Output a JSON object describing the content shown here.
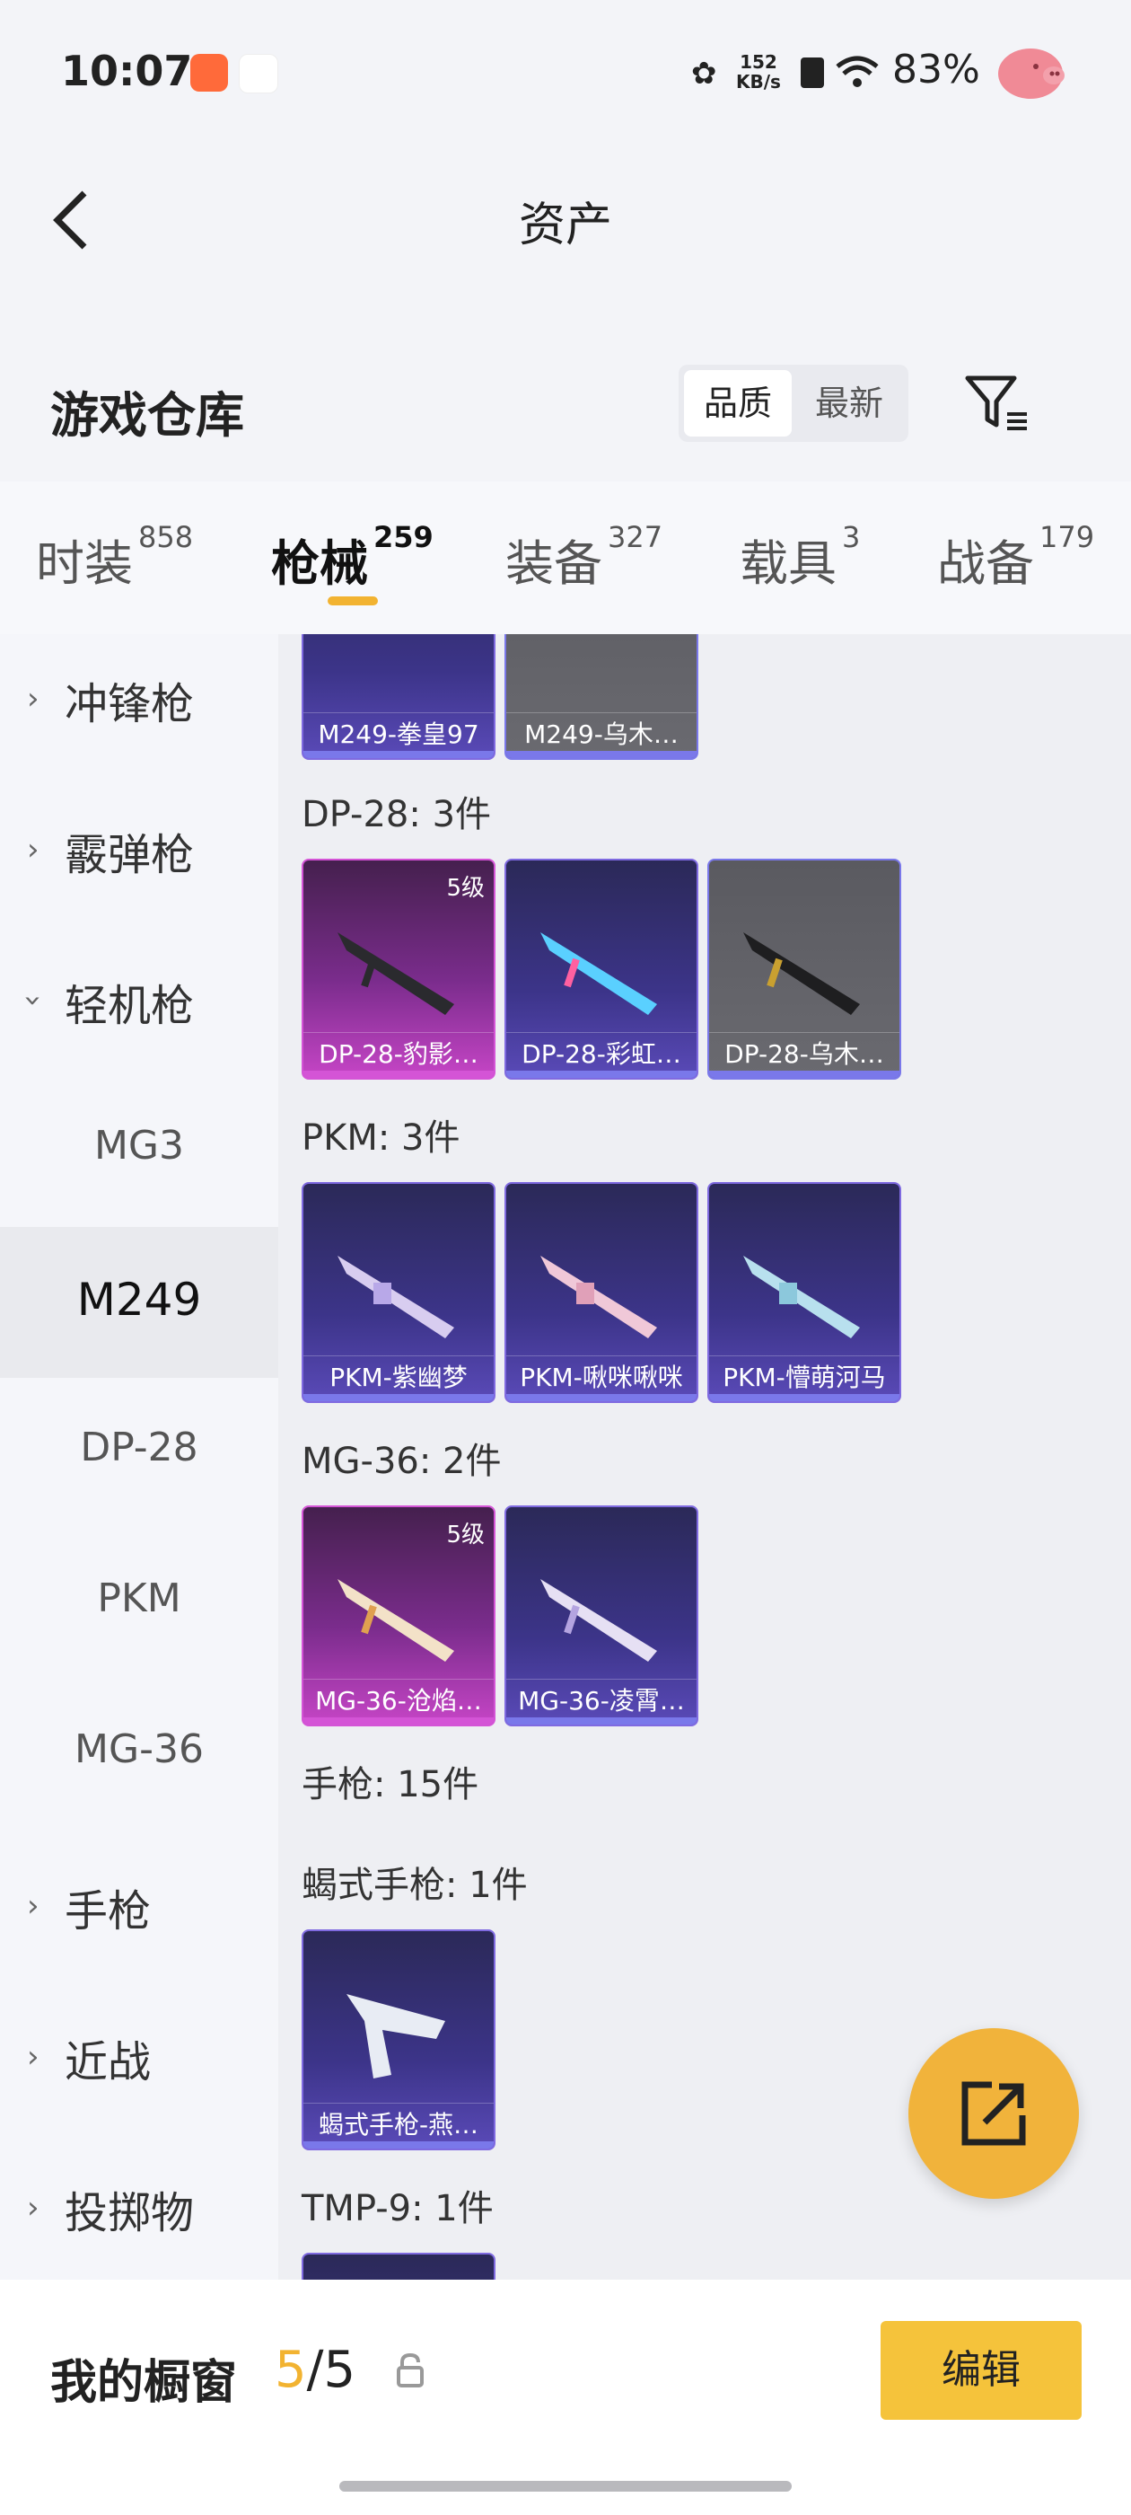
{
  "status": {
    "time": "10:07",
    "net_speed_value": "152",
    "net_speed_unit": "KB/s",
    "battery": "83%"
  },
  "header": {
    "title": "资产"
  },
  "warehouse": {
    "title": "游戏仓库",
    "sort_quality": "品质",
    "sort_latest": "最新"
  },
  "tabs": [
    {
      "label": "时装",
      "count": "858"
    },
    {
      "label": "枪械",
      "count": "259"
    },
    {
      "label": "装备",
      "count": "327"
    },
    {
      "label": "载具",
      "count": "3"
    },
    {
      "label": "战备",
      "count": "179"
    }
  ],
  "sidebar": {
    "categories": [
      {
        "label": "冲锋枪"
      },
      {
        "label": "霰弹枪"
      },
      {
        "label": "轻机枪"
      },
      {
        "label": "手枪"
      },
      {
        "label": "近战"
      },
      {
        "label": "投掷物"
      }
    ],
    "subitems": [
      {
        "label": "MG3"
      },
      {
        "label": "M249"
      },
      {
        "label": "DP-28"
      },
      {
        "label": "PKM"
      },
      {
        "label": "MG-36"
      }
    ]
  },
  "content": {
    "partial_row": [
      {
        "name": "M249-拳皇97"
      },
      {
        "name": "M249-乌木…"
      }
    ],
    "groups": [
      {
        "heading": "DP-28: 3件",
        "items": [
          {
            "name": "DP-28-豹影…",
            "level": "5级"
          },
          {
            "name": "DP-28-彩虹…"
          },
          {
            "name": "DP-28-乌木…"
          }
        ]
      },
      {
        "heading": "PKM: 3件",
        "items": [
          {
            "name": "PKM-紫幽梦"
          },
          {
            "name": "PKM-啾咪啾咪"
          },
          {
            "name": "PKM-懵萌河马"
          }
        ]
      },
      {
        "heading": "MG-36: 2件",
        "items": [
          {
            "name": "MG-36-沧焰…",
            "level": "5级"
          },
          {
            "name": "MG-36-凌霄…"
          }
        ]
      },
      {
        "heading": "手枪: 15件",
        "items": []
      },
      {
        "heading": "蝎式手枪: 1件",
        "items": [
          {
            "name": "蝎式手枪-燕…"
          }
        ]
      },
      {
        "heading": "TMP-9: 1件",
        "items": []
      }
    ]
  },
  "bottom": {
    "label": "我的橱窗",
    "current": "5",
    "separator": "/",
    "total": "5",
    "edit": "编辑"
  },
  "colors": {
    "accent": "#f2b331",
    "purple_border": "#7a78ea",
    "pink_border": "#d454d6"
  },
  "icons": [
    "back-arrow-icon",
    "filter-icon",
    "chevron-right-icon",
    "chevron-down-icon",
    "lock-icon",
    "share-edit-icon",
    "wifi-icon",
    "battery-icon"
  ]
}
